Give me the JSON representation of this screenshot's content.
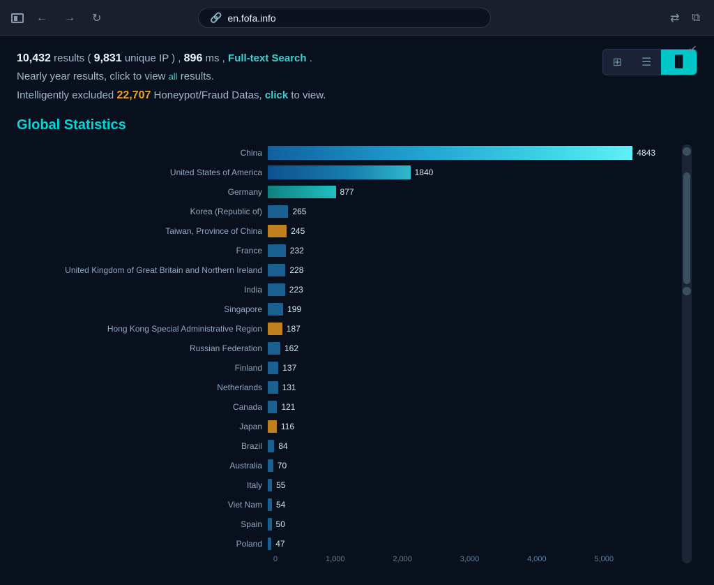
{
  "browser": {
    "url": "en.fofa.info",
    "back_label": "←",
    "forward_label": "→",
    "refresh_label": "↻"
  },
  "stats": {
    "total_results": "10,432",
    "unique_ip": "9,831",
    "ms": "896",
    "line1_pre": " results ( ",
    "line1_mid": " unique IP ) ,",
    "line1_post": " ms ,",
    "fulltext": "Full-text Search",
    "line2_pre": "Nearly year results, click to view ",
    "line2_all": "all",
    "line2_post": " results.",
    "line3_pre": "Intelligently excluded ",
    "line3_num": "22,707",
    "line3_mid": " Honeypot/Fraud Datas, ",
    "line3_click": "click",
    "line3_post": " to view."
  },
  "view_buttons": [
    {
      "id": "grid",
      "icon": "⊞",
      "active": false
    },
    {
      "id": "list",
      "icon": "☰",
      "active": false
    },
    {
      "id": "chart",
      "icon": "📊",
      "active": true
    }
  ],
  "section_title": "Global Statistics",
  "chart": {
    "max_value": 4843,
    "display_max": 5000,
    "countries": [
      {
        "name": "China",
        "value": 4843,
        "color": "#1a8fcc"
      },
      {
        "name": "United States of America",
        "value": 1840,
        "color": "#1a8fcc"
      },
      {
        "name": "Germany",
        "value": 877,
        "color": "#20c0c0"
      },
      {
        "name": "Korea (Republic of)",
        "value": 265,
        "color": "#1a6090"
      },
      {
        "name": "Taiwan, Province of China",
        "value": 245,
        "color": "#c08020"
      },
      {
        "name": "France",
        "value": 232,
        "color": "#1a6090"
      },
      {
        "name": "United Kingdom of Great Britain and Northern Ireland",
        "value": 228,
        "color": "#1a6090"
      },
      {
        "name": "India",
        "value": 223,
        "color": "#1a6090"
      },
      {
        "name": "Singapore",
        "value": 199,
        "color": "#1a6090"
      },
      {
        "name": "Hong Kong Special Administrative Region",
        "value": 187,
        "color": "#c08020"
      },
      {
        "name": "Russian Federation",
        "value": 162,
        "color": "#1a6090"
      },
      {
        "name": "Finland",
        "value": 137,
        "color": "#1a6090"
      },
      {
        "name": "Netherlands",
        "value": 131,
        "color": "#1a6090"
      },
      {
        "name": "Canada",
        "value": 121,
        "color": "#1a6090"
      },
      {
        "name": "Japan",
        "value": 116,
        "color": "#c08020"
      },
      {
        "name": "Brazil",
        "value": 84,
        "color": "#1a6090"
      },
      {
        "name": "Australia",
        "value": 70,
        "color": "#1a6090"
      },
      {
        "name": "Italy",
        "value": 55,
        "color": "#1a6090"
      },
      {
        "name": "Viet Nam",
        "value": 54,
        "color": "#1a6090"
      },
      {
        "name": "Spain",
        "value": 50,
        "color": "#1a6090"
      },
      {
        "name": "Poland",
        "value": 47,
        "color": "#1a6090"
      }
    ],
    "x_axis_labels": [
      "0",
      "1,000",
      "2,000",
      "3,000",
      "4,000",
      "5,000"
    ]
  }
}
